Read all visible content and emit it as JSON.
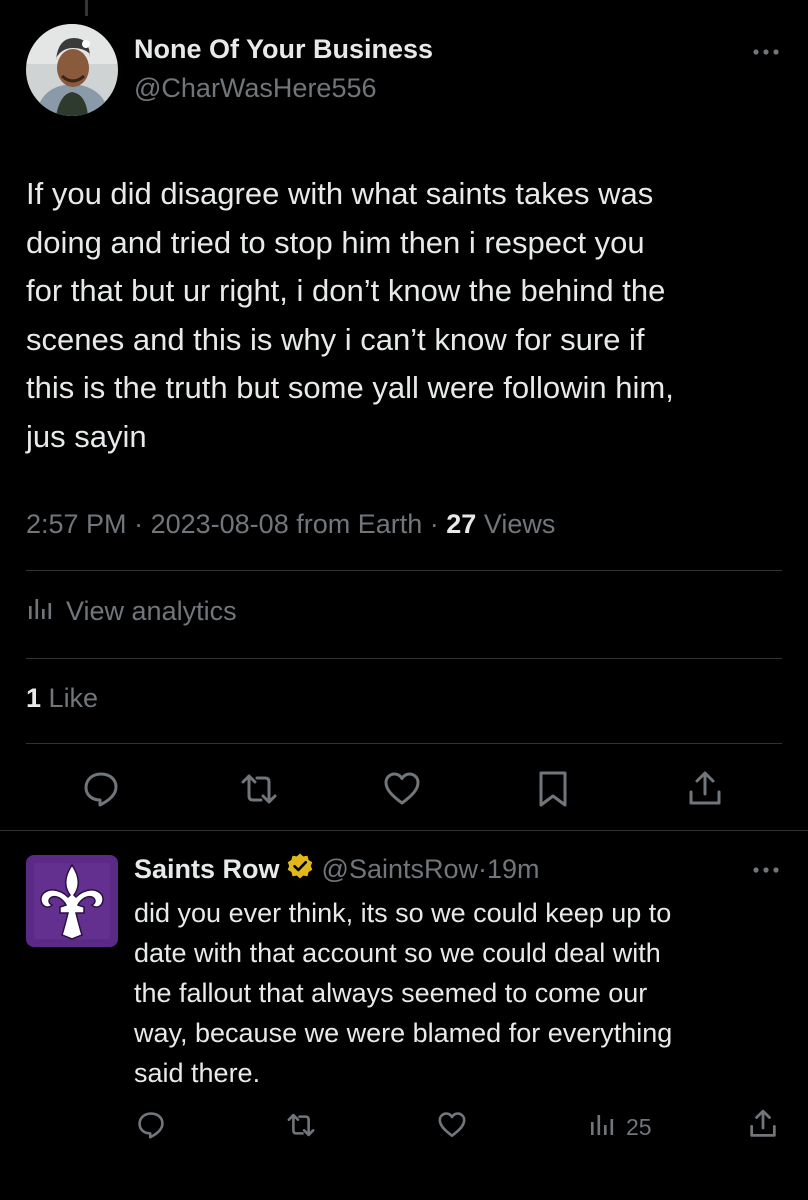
{
  "main_tweet": {
    "author_name": "None Of Your Business",
    "author_handle": "@CharWasHere556",
    "text": "If you did disagree with what saints takes was\ndoing and tried to stop him then i respect you\nfor that but ur right, i don’t know the behind the\nscenes and this is why i can’t know for sure if\nthis is the truth but some yall were followin him,\njus sayin",
    "time": "2:57 PM",
    "separator": "·",
    "date": "2023-08-08 from Earth",
    "views_count": "27",
    "views_label": "Views",
    "analytics_label": "View analytics",
    "likes_count": "1",
    "likes_label": "Like"
  },
  "reply": {
    "author_name": "Saints Row",
    "author_handle": "@SaintsRow",
    "separator": "·",
    "time": "19m",
    "text": "did you ever think, its so we could keep up to\ndate with that account so we could deal with\nthe fallout that always seemed to come our\nway, because we were blamed for everything\nsaid there.",
    "views_count": "25"
  },
  "icons": {
    "reply": "reply-icon",
    "retweet": "retweet-icon",
    "like": "heart-icon",
    "bookmark": "bookmark-icon",
    "share": "share-icon",
    "analytics": "analytics-icon",
    "more": "more-icon",
    "verified": "verified-badge-icon"
  },
  "colors": {
    "background": "#000000",
    "text": "#e7e9ea",
    "secondary": "#71767b",
    "divider": "#2f3336",
    "verified_gold": "#e2b719",
    "saints_purple": "#5b2a86"
  }
}
